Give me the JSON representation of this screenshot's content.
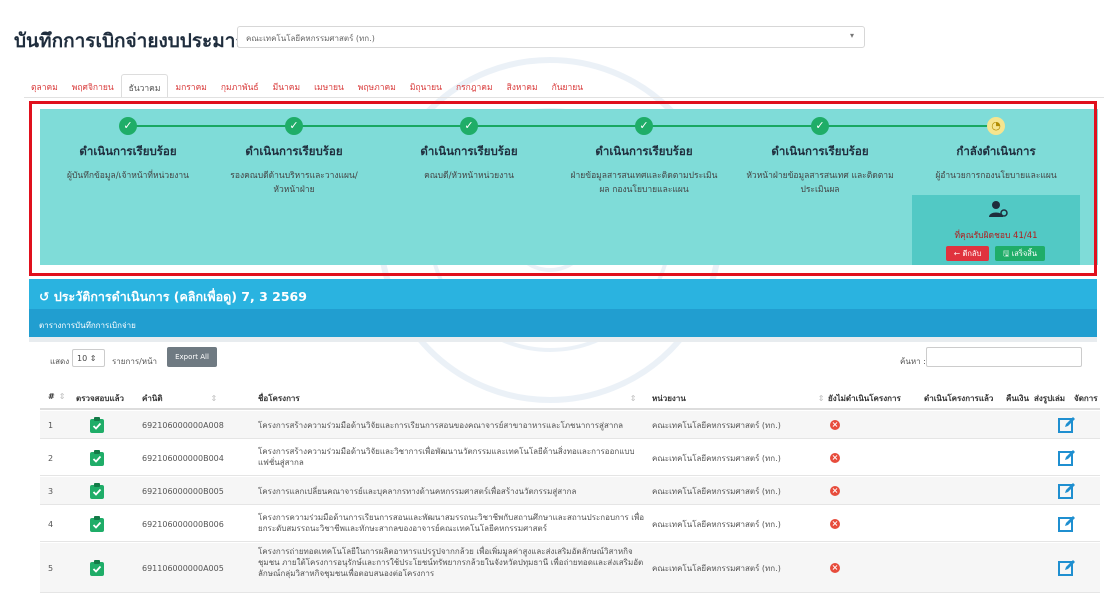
{
  "header": {
    "title": "บันทึกการเบิกจ่ายงบประมาณ",
    "unit_select_value": "คณะเทคโนโลยีคหกรรมศาสตร์ (ทก.)"
  },
  "tabs": [
    {
      "label": "ตุลาคม",
      "active": false
    },
    {
      "label": "พฤศจิกายน",
      "active": false
    },
    {
      "label": "ธันวาคม",
      "active": true
    },
    {
      "label": "มกราคม",
      "active": false
    },
    {
      "label": "กุมภาพันธ์",
      "active": false
    },
    {
      "label": "มีนาคม",
      "active": false
    },
    {
      "label": "เมษายน",
      "active": false
    },
    {
      "label": "พฤษภาคม",
      "active": false
    },
    {
      "label": "มิถุนายน",
      "active": false
    },
    {
      "label": "กรกฎาคม",
      "active": false
    },
    {
      "label": "สิงหาคม",
      "active": false
    },
    {
      "label": "กันยายน",
      "active": false
    }
  ],
  "steps": [
    {
      "title": "ดำเนินการเรียบร้อย",
      "sub": "ผู้บันทึกข้อมูล/เจ้าหน้าที่หน่วยงาน",
      "status": "done"
    },
    {
      "title": "ดำเนินการเรียบร้อย",
      "sub": "รองคณบดีด้านบริหารและวางแผน/หัวหน้าฝ่าย",
      "status": "done"
    },
    {
      "title": "ดำเนินการเรียบร้อย",
      "sub": "คณบดี/หัวหน้าหน่วยงาน",
      "status": "done"
    },
    {
      "title": "ดำเนินการเรียบร้อย",
      "sub": "ฝ่ายข้อมูลสารสนเทศและติดตามประเมินผล กองนโยบายและแผน",
      "status": "done"
    },
    {
      "title": "ดำเนินการเรียบร้อย",
      "sub": "หัวหน้าฝ่ายข้อมูลสารสนเทศ และติดตามประเมินผล",
      "status": "done"
    },
    {
      "title": "กำลังดำเนินการ",
      "sub": "ผู้อำนวยการกองนโยบายและแผน",
      "status": "pending"
    }
  ],
  "account_box": {
    "text": "ที่คุณรับผิดชอบ 41/41",
    "back_label": "← ตีกลับ",
    "finish_label": "🖫 เสร็จสิ้น"
  },
  "history": {
    "title": "ประวัติการดำเนินการ (คลิกเพื่อดู) 7, 3 2569",
    "section_title": "ตารางการบันทึกการเบิกจ่าย"
  },
  "controls": {
    "show_label": "แสดง",
    "page_size": "10",
    "per_page_label": "รายการ/หน้า",
    "export_label": "Export All",
    "search_label": "ค้นหา :"
  },
  "table": {
    "headers": [
      "#",
      "ตรวจสอบแล้ว",
      "คำนิติ",
      "ชื่อโครงการ",
      "หน่วยงาน",
      "ยังไม่ดำเนินโครงการ",
      "ดำเนินโครงการแล้ว",
      "คืนเงิน",
      "ส่งรูปเล่ม",
      "จัดการ"
    ],
    "rows": [
      {
        "no": "1",
        "code": "692106000000A008",
        "name": "โครงการสร้างความร่วมมือด้านวิจัยและการเรียนการสอนของคณาจารย์สาขาอาหารและโภชนาการสู่สากล",
        "unit": "คณะเทคโนโลยีคหกรรมศาสตร์ (ทก.)"
      },
      {
        "no": "2",
        "code": "692106000000B004",
        "name": "โครงการสร้างความร่วมมือด้านวิจัยและวิชาการเพื่อพัฒนานวัตกรรมและเทคโนโลยีด้านสิ่งทอและการออกแบบแฟชั่นสู่สากล",
        "unit": "คณะเทคโนโลยีคหกรรมศาสตร์ (ทก.)"
      },
      {
        "no": "3",
        "code": "692106000000B005",
        "name": "โครงการแลกเปลี่ยนคณาจารย์และบุคลากรทางด้านคหกรรมศาสตร์เพื่อสร้างนวัตกรรมสู่สากล",
        "unit": "คณะเทคโนโลยีคหกรรมศาสตร์ (ทก.)"
      },
      {
        "no": "4",
        "code": "692106000000B006",
        "name": "โครงการความร่วมมือด้านการเรียนการสอนและพัฒนาสมรรถนะวิชาชีพกับสถานศึกษาและสถานประกอบการ เพื่อยกระดับสมรรถนะวิชาชีพและทักษะสากลของอาจารย์คณะเทคโนโลยีคหกรรมศาสตร์",
        "unit": "คณะเทคโนโลยีคหกรรมศาสตร์ (ทก.)"
      },
      {
        "no": "5",
        "code": "691106000000A005",
        "name": "โครงการถ่ายทอดเทคโนโลยีในการผลิตอาหารแปรรูปจากกล้วย เพื่อเพิ่มมูลค่าสูงและส่งเสริมอัตลักษณ์วิสาหกิจชุมชน ภายใต้โครงการอนุรักษ์และการใช้ประโยชน์ทรัพยากรกล้วยในจังหวัดปทุมธานี เพื่อถ่ายทอดและส่งเสริมอัตลักษณ์กลุ่มวิสาหกิจชุมชนเพื่อตอบสนองต่อโครงการ",
        "unit": "คณะเทคโนโลยีคหกรรมศาสตร์ (ทก.)"
      }
    ]
  },
  "colors": {
    "step_panel": "#7fdcd8",
    "done": "#1fad68",
    "highlight_border": "#e0101d",
    "history_bar": "#2ab3e0",
    "tab_text": "#d93a3a"
  },
  "icons": [
    "check-circle-icon",
    "hourglass-icon",
    "user-check-icon",
    "history-icon",
    "clipboard-check-icon",
    "x-circle-icon",
    "edit-icon",
    "chevron-down-icon"
  ]
}
